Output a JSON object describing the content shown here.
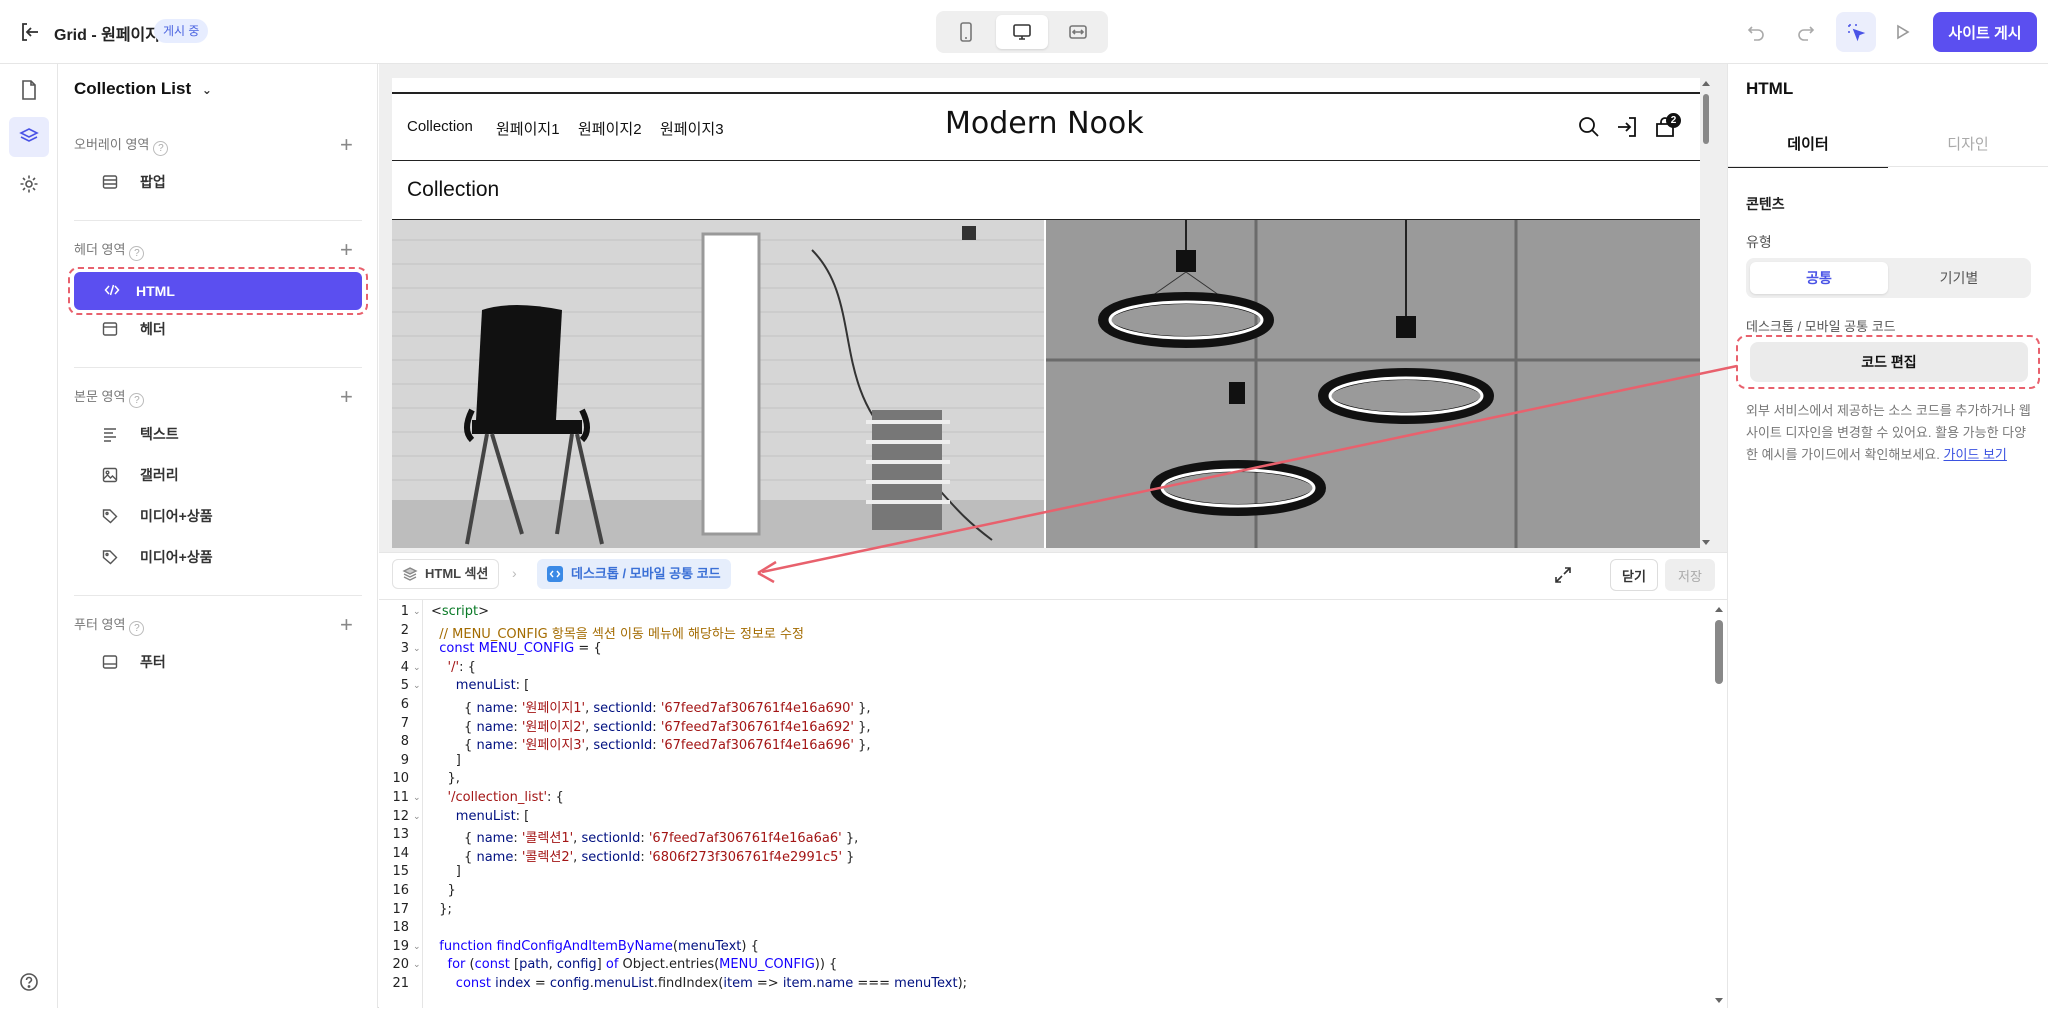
{
  "topbar": {
    "title": "Grid - 원페이지",
    "status_badge": "게시 중",
    "publish_label": "사이트 게시"
  },
  "layers": {
    "title": "Collection List",
    "sections": [
      {
        "label": "오버레이 영역",
        "items": [
          "팝업"
        ]
      },
      {
        "label": "헤더 영역",
        "items": [
          "HTML",
          "헤더"
        ]
      },
      {
        "label": "본문 영역",
        "items": [
          "텍스트",
          "갤러리",
          "미디어+상품",
          "미디어+상품"
        ]
      },
      {
        "label": "푸터 영역",
        "items": [
          "푸터"
        ]
      }
    ],
    "selected": "HTML"
  },
  "preview": {
    "nav": [
      "Collection",
      "원페이지1",
      "원페이지2",
      "원페이지3"
    ],
    "logo": "Modern Nook",
    "cart_count": "2",
    "section_title": "Collection"
  },
  "editor": {
    "breadcrumb_section": "HTML 섹션",
    "breadcrumb_current": "데스크톱 / 모바일 공통 코드",
    "close_label": "닫기",
    "save_label": "저장",
    "lines": [
      "<script>",
      "  // MENU_CONFIG 항목을 섹션 이동 메뉴에 해당하는 정보로 수정",
      "  const MENU_CONFIG = {",
      "    '/': {",
      "      menuList: [",
      "        { name: '원페이지1', sectionId: '67feed7af306761f4e16a690' },",
      "        { name: '원페이지2', sectionId: '67feed7af306761f4e16a692' },",
      "        { name: '원페이지3', sectionId: '67feed7af306761f4e16a696' },",
      "      ]",
      "    },",
      "    '/collection_list': {",
      "      menuList: [",
      "        { name: '콜렉션1', sectionId: '67feed7af306761f4e16a6a6' },",
      "        { name: '콜렉션2', sectionId: '6806f273f306761f4e2991c5' }",
      "      ]",
      "    }",
      "  };",
      "",
      "  function findConfigAndItemByName(menuText) {",
      "    for (const [path, config] of Object.entries(MENU_CONFIG)) {",
      "      const index = config.menuList.findIndex(item => item.name === menuText);"
    ]
  },
  "right_panel": {
    "title": "HTML",
    "tabs": [
      "데이터",
      "디자인"
    ],
    "contents_label": "콘텐츠",
    "type_label": "유형",
    "type_options": [
      "공통",
      "기기별"
    ],
    "code_label": "데스크톱 / 모바일 공통 코드",
    "code_edit_label": "코드 편집",
    "description": "외부 서비스에서 제공하는 소스 코드를 추가하거나 웹사이트 디자인을 변경할 수 있어요. 활용 가능한 다양한 예시를 가이드에서 확인해보세요.",
    "guide_link": "가이드 보기"
  },
  "colors": {
    "accent": "#5b4ff0",
    "highlight_dash": "#e8616d",
    "arrow": "#e8616d"
  }
}
